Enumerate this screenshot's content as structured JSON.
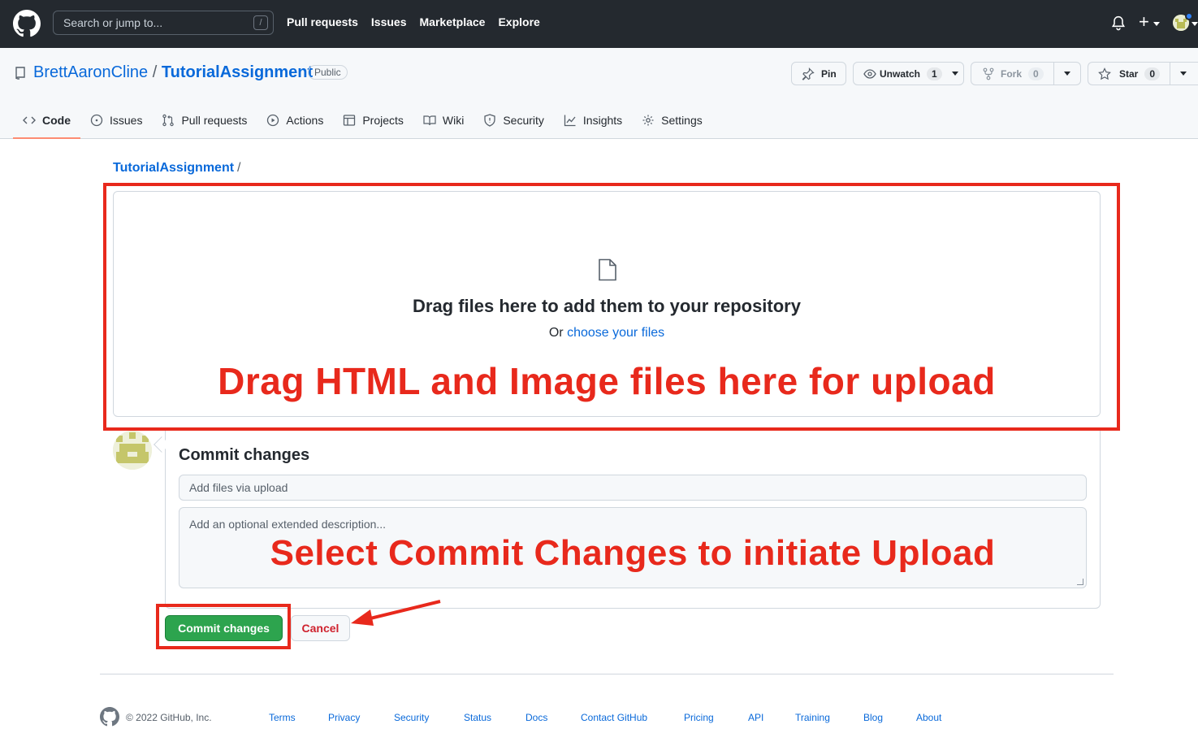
{
  "header": {
    "search_placeholder": "Search or jump to...",
    "search_shortcut": "/",
    "nav": [
      "Pull requests",
      "Issues",
      "Marketplace",
      "Explore"
    ]
  },
  "repo": {
    "owner": "BrettAaronCline",
    "separator": "/",
    "name": "TutorialAssignment",
    "visibility": "Public",
    "actions": {
      "pin": "Pin",
      "unwatch": "Unwatch",
      "watch_count": "1",
      "fork": "Fork",
      "fork_count": "0",
      "star": "Star",
      "star_count": "0"
    },
    "tabs": [
      "Code",
      "Issues",
      "Pull requests",
      "Actions",
      "Projects",
      "Wiki",
      "Security",
      "Insights",
      "Settings"
    ],
    "active_tab": "Code"
  },
  "breadcrumb": {
    "repo": "TutorialAssignment",
    "separator": "/"
  },
  "upload": {
    "title": "Drag files here to add them to your repository",
    "or_text": "Or",
    "choose_link": "choose your files",
    "annotation": "Drag HTML and Image files here for upload"
  },
  "commit": {
    "title": "Commit changes",
    "message_placeholder": "Add files via upload",
    "description_placeholder": "Add an optional extended description...",
    "annotation": "Select Commit Changes to initiate Upload",
    "commit_button": "Commit changes",
    "cancel_button": "Cancel"
  },
  "footer": {
    "copyright": "© 2022 GitHub, Inc.",
    "links": [
      "Terms",
      "Privacy",
      "Security",
      "Status",
      "Docs",
      "Contact GitHub",
      "Pricing",
      "API",
      "Training",
      "Blog",
      "About"
    ]
  },
  "colors": {
    "header_bg": "#24292f",
    "link": "#0969da",
    "annotation_red": "#e8291c",
    "commit_green": "#2da44e",
    "cancel_red": "#cf222e"
  }
}
